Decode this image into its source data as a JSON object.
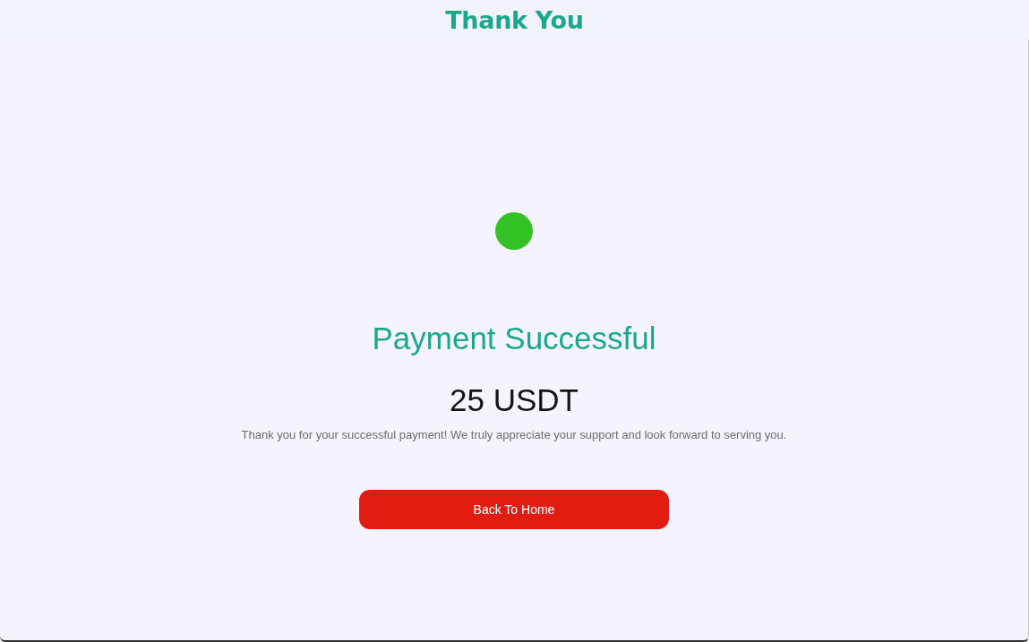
{
  "header": {
    "title": "Thank You"
  },
  "confirmation": {
    "heading": "Payment Successful",
    "amount": "25 USDT",
    "message": "Thank you for your successful payment! We truly appreciate your support and look forward to serving you."
  },
  "button": {
    "label": "Back To Home"
  }
}
